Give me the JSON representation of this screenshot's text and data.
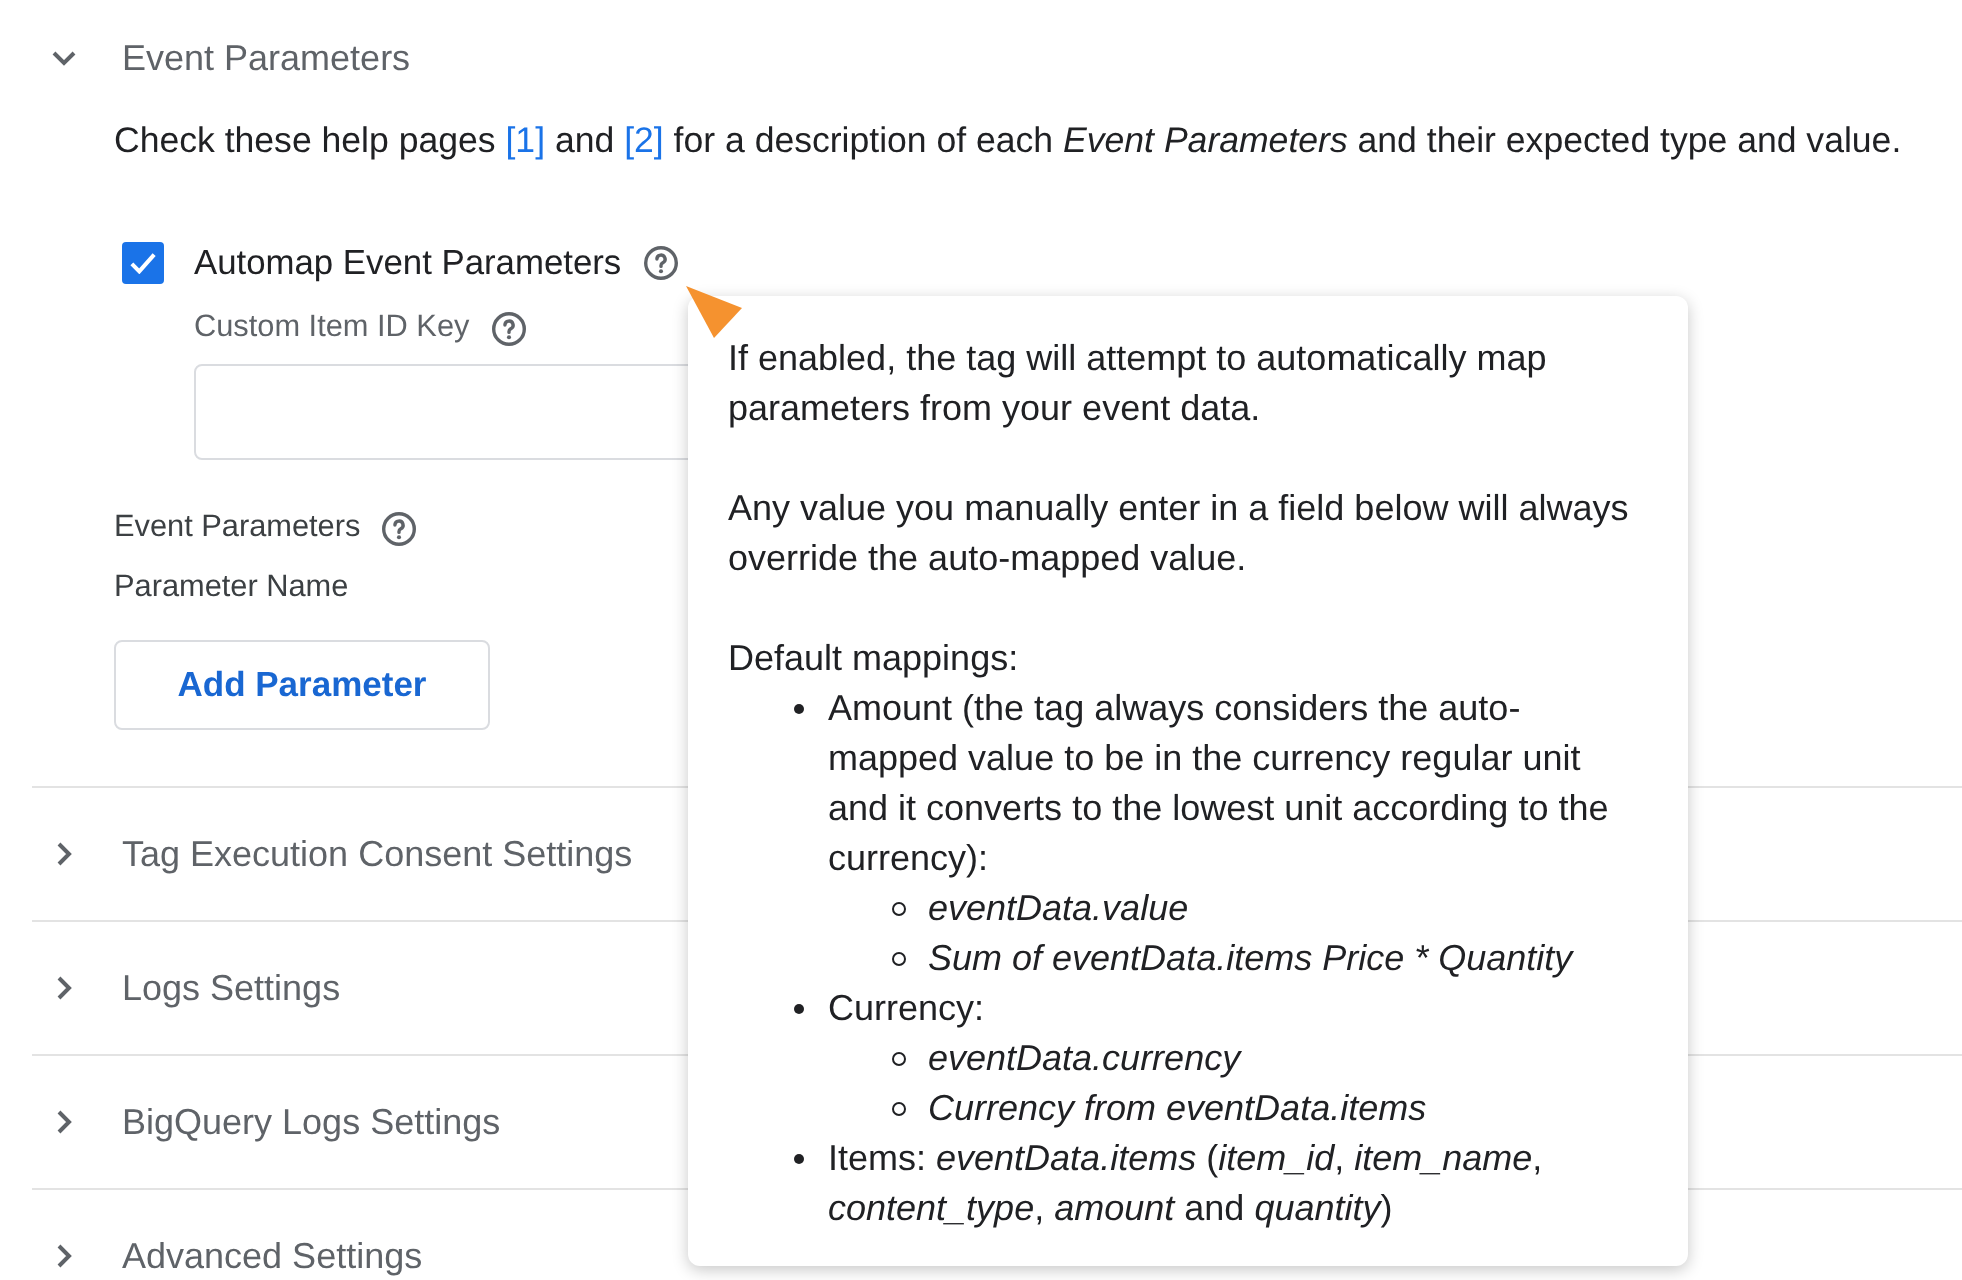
{
  "sections": [
    {
      "title": "Event Parameters",
      "expanded": true,
      "description": [
        {
          "kind": "text",
          "text": "Check these help pages "
        },
        {
          "kind": "link",
          "text": "[1]"
        },
        {
          "kind": "text",
          "text": " and "
        },
        {
          "kind": "link",
          "text": "[2]"
        },
        {
          "kind": "text",
          "text": " for a description of each *Event Parameters* and their expected type and value."
        }
      ],
      "automap": {
        "label": "Automap Event Parameters",
        "checked": true
      },
      "custom_item_id_key": {
        "label": "Custom Item ID Key"
      },
      "event_parameters": {
        "label": "Event Parameters",
        "column_header": "Parameter Name",
        "add_button": "Add Parameter"
      }
    },
    {
      "title": "Tag Execution Consent Settings",
      "expanded": false
    },
    {
      "title": "Logs Settings",
      "expanded": false
    },
    {
      "title": "BigQuery Logs Settings",
      "expanded": false
    },
    {
      "title": "Advanced Settings",
      "expanded": false
    }
  ],
  "tooltip": {
    "paragraphs": [
      "If enabled, the tag will attempt to automatically map parameters from your event data.",
      "Any value you manually enter in a field below will always override the auto-mapped value."
    ],
    "list_heading": "Default mappings:",
    "items": [
      {
        "text": "Amount (the tag always considers the auto-mapped value to be in the currency regular unit and it converts to the lowest unit according to the currency):",
        "children": [
          {
            "text": "eventData.value"
          },
          {
            "text": "Sum of eventData.items Price * Quantity"
          }
        ]
      },
      {
        "text": "Currency:",
        "children": [
          {
            "text": "eventData.currency"
          },
          {
            "text": "Currency from eventData.items"
          }
        ]
      },
      {
        "text": "Items: *eventData.items* (*item_id*, *item_name*, *content_type*, *amount* and *quantity*)"
      }
    ]
  }
}
